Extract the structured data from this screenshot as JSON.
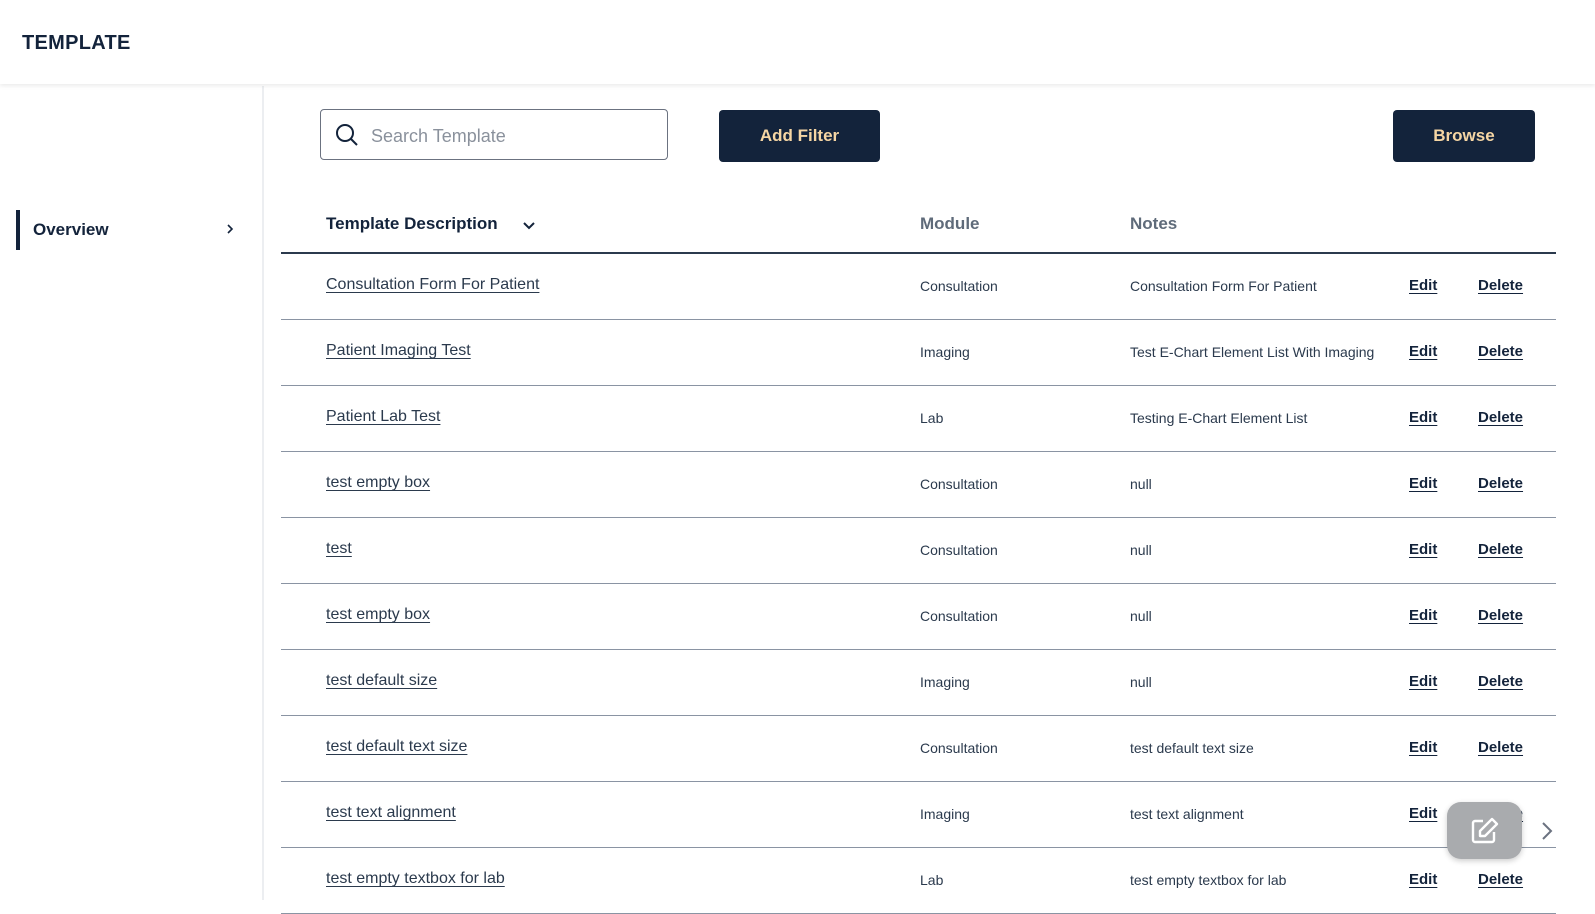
{
  "header": {
    "title": "TEMPLATE"
  },
  "sidebar": {
    "items": [
      {
        "label": "Overview",
        "active": true
      }
    ]
  },
  "toolbar": {
    "search_placeholder": "Search Template",
    "search_value": "",
    "add_filter_label": "Add Filter",
    "browse_label": "Browse"
  },
  "table": {
    "columns": {
      "description": "Template Description",
      "module": "Module",
      "notes": "Notes"
    },
    "edit_label": "Edit",
    "delete_label": "Delete",
    "rows": [
      {
        "description": "Consultation Form For Patient",
        "module": "Consultation",
        "notes": "Consultation Form For Patient"
      },
      {
        "description": "Patient Imaging Test",
        "module": "Imaging",
        "notes": "Test E-Chart Element List With Imaging"
      },
      {
        "description": "Patient Lab Test",
        "module": "Lab",
        "notes": "Testing E-Chart Element List"
      },
      {
        "description": "test empty box",
        "module": "Consultation",
        "notes": "null"
      },
      {
        "description": "test",
        "module": "Consultation",
        "notes": "null"
      },
      {
        "description": "test empty box",
        "module": "Consultation",
        "notes": "null"
      },
      {
        "description": "test default size",
        "module": "Imaging",
        "notes": "null"
      },
      {
        "description": "test default text size",
        "module": "Consultation",
        "notes": "test default text size"
      },
      {
        "description": "test text alignment",
        "module": "Imaging",
        "notes": "test text alignment"
      },
      {
        "description": "test empty textbox for lab",
        "module": "Lab",
        "notes": "test empty textbox for lab"
      }
    ]
  },
  "colors": {
    "primary": "#13233b",
    "button_text": "#f6d6a4",
    "fab": "#a9abae"
  },
  "icons": {
    "search": "search-icon",
    "chevron_right": "chevron-right-icon",
    "chevron_down": "chevron-down-icon",
    "edit_fab": "edit-note-icon"
  }
}
